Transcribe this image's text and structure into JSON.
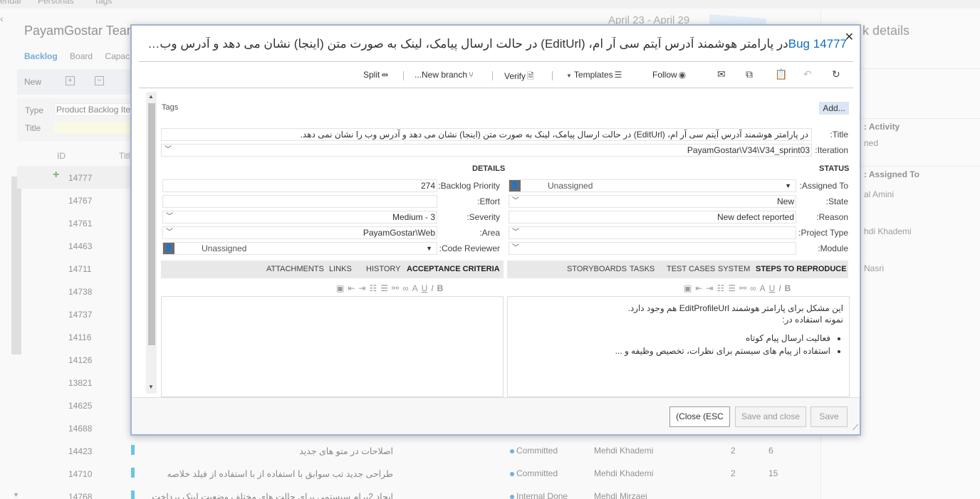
{
  "background": {
    "topnav": [
      "endar",
      "Personas",
      "Tags"
    ],
    "team_name": "PayamGostar Team",
    "sprint_dates": "April 23 - April 29",
    "tabs": [
      "Backlog",
      "Board",
      "Capac"
    ],
    "toolbar_new": "New",
    "filter": {
      "type_label": "Type",
      "type_value": "Product Backlog Iter",
      "title_label": "Title"
    },
    "columns": {
      "id": "ID",
      "title": "Titl"
    },
    "rows": [
      {
        "id": "14777",
        "title": "",
        "state": "",
        "who": "",
        "n1": "",
        "n2": ""
      },
      {
        "id": "14767",
        "title": "",
        "state": "",
        "who": "",
        "n1": "",
        "n2": ""
      },
      {
        "id": "14761",
        "title": "",
        "state": "",
        "who": "",
        "n1": "",
        "n2": ""
      },
      {
        "id": "14463",
        "title": "",
        "state": "",
        "who": "",
        "n1": "",
        "n2": ""
      },
      {
        "id": "14711",
        "title": "",
        "state": "",
        "who": "",
        "n1": "",
        "n2": ""
      },
      {
        "id": "14738",
        "title": "",
        "state": "",
        "who": "",
        "n1": "",
        "n2": ""
      },
      {
        "id": "14737",
        "title": "",
        "state": "",
        "who": "",
        "n1": "",
        "n2": ""
      },
      {
        "id": "14116",
        "title": "",
        "state": "",
        "who": "",
        "n1": "",
        "n2": ""
      },
      {
        "id": "14126",
        "title": "",
        "state": "",
        "who": "",
        "n1": "",
        "n2": ""
      },
      {
        "id": "13821",
        "title": "",
        "state": "",
        "who": "",
        "n1": "",
        "n2": ""
      },
      {
        "id": "14625",
        "title": "",
        "state": "",
        "who": "",
        "n1": "",
        "n2": ""
      },
      {
        "id": "14688",
        "title": "",
        "state": "",
        "who": "",
        "n1": "",
        "n2": ""
      },
      {
        "id": "14423",
        "title": "اصلاحات در متو های جدید",
        "state": "Committed",
        "who": "Mehdi Khademi",
        "n1": "2",
        "n2": "6"
      },
      {
        "id": "14710",
        "title": "طراحی جدید تب سوابق با استفاده از با استفاده از فیلد خلاصه",
        "state": "Committed",
        "who": "Mehdi Khademi",
        "n1": "2",
        "n2": "15"
      },
      {
        "id": "14768",
        "title": "ایجاد 2برام سیستمی برای حالت های مختلف وضعیت لینک پرداخت",
        "state": "Internal Done",
        "who": "Mehdi Mirzaei",
        "n1": "",
        "n2": ""
      }
    ],
    "right_panel": {
      "header": "k details",
      "sub1": ": Activity",
      "item1": "ned",
      "sub2": ": Assigned To",
      "items2": [
        "al Amini",
        "hdi Khademi",
        "Nasri"
      ]
    }
  },
  "dialog": {
    "bug_id": "Bug 14777",
    "title_text": "در پارامتر هوشمند آدرس آیتم سی آر ام، (EditUrl) در حالت ارسال پیامک، لینک به صورت متن (اینجا) نشان می دهد و آدرس وب را نشان...",
    "toolbar": {
      "split": "Split",
      "new_branch": "...New branch",
      "verify": "Verify",
      "templates": "Templates",
      "follow": "Follow"
    },
    "tags_label": "Tags",
    "add_label": "Add...",
    "title_label": ":Title",
    "title_value": "در پارامتر هوشمند آدرس آیتم سی آر ام، (EditUrl) در حالت ارسال پیامک، لینک به صورت متن (اینجا) نشان می دهد و آدرس وب را نشان نمی دهد.",
    "iteration_label": ":Iteration",
    "iteration_value": "PayamGostar\\V34\\V34_sprint03",
    "status_header": "STATUS",
    "details_header": "DETAILS",
    "status": {
      "assigned_label": ":Assigned To",
      "assigned_value": "Unassigned",
      "state_label": ":State",
      "state_value": "New",
      "reason_label": ":Reason",
      "reason_value": "New defect reported",
      "project_type_label": ":Project Type",
      "project_type_value": "",
      "module_label": ":Module",
      "module_value": ""
    },
    "details": {
      "priority_label": ":Backlog Priority",
      "priority_value": "274",
      "effort_label": ":Effort",
      "effort_value": "",
      "severity_label": ":Severity",
      "severity_value": "Medium - 3",
      "area_label": ":Area",
      "area_value": "PayamGostar\\Web",
      "reviewer_label": ":Code Reviewer",
      "reviewer_value": "Unassigned"
    },
    "right_tabs": [
      "STEPS TO REPRODUCE",
      "SYSTEM",
      "TEST CASES",
      "TASKS",
      "STORYBOARDS"
    ],
    "left_tabs": [
      "ACCEPTANCE CRITERIA",
      "HISTORY",
      "LINKS",
      "ATTACHMENTS"
    ],
    "steps": {
      "line1": "این مشکل برای پارامتر هوشمند EditProfileUrl هم وجود دارد.",
      "line2": "نمونه استفاده در:",
      "bullets": [
        "فعالیت ارسال پیام کوتاه",
        "استفاده از پیام های سیستم برای نظرات، تخصیص وظیفه و ..."
      ]
    },
    "footer": {
      "close": "(Close (ESC",
      "save_close": "Save and close",
      "save": "Save"
    }
  }
}
